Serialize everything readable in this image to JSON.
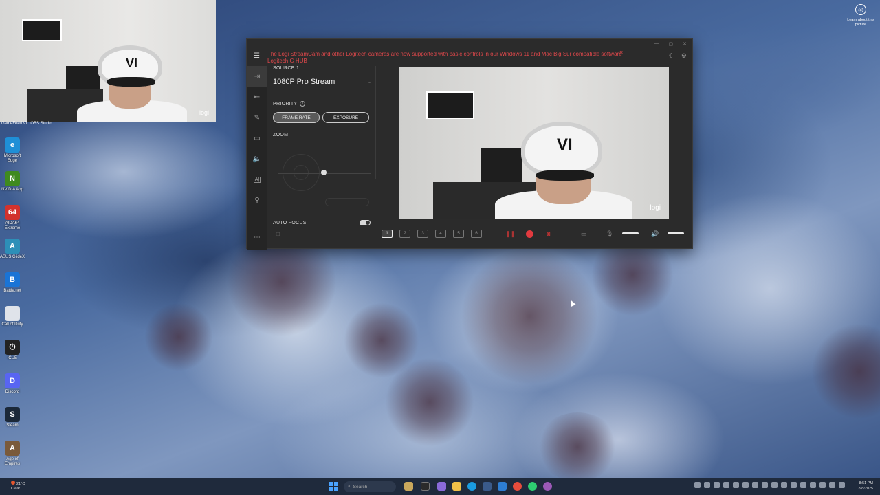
{
  "webcam_overlay": {
    "logo": "logi",
    "cap_text": "VI"
  },
  "desktop": {
    "top_labels": [
      "GameFeed VI",
      "OBS Studio"
    ],
    "icons": [
      {
        "label": "Microsoft Edge",
        "icon": "edge-icon",
        "color": "#1f8fd6",
        "glyph": "e"
      },
      {
        "label": "NVIDIA App",
        "icon": "nvidia-icon",
        "color": "#3f8a1f",
        "glyph": "N"
      },
      {
        "label": "AIDA64 Extreme",
        "icon": "aida64-icon",
        "color": "#d2322d",
        "glyph": "64"
      },
      {
        "label": "ASUS GlideX",
        "icon": "asus-icon",
        "color": "#2d8fb8",
        "glyph": "A"
      },
      {
        "label": "Battle.net",
        "icon": "battlenet-icon",
        "color": "#1a74d6",
        "glyph": "B"
      },
      {
        "label": "Call of Duty",
        "icon": "file-icon",
        "color": "#dfe3ea",
        "glyph": ""
      },
      {
        "label": "iCUE",
        "icon": "icue-icon",
        "color": "#222222",
        "glyph": "⏻"
      },
      {
        "label": "Discord",
        "icon": "discord-icon",
        "color": "#5865f2",
        "glyph": "D"
      },
      {
        "label": "Steam",
        "icon": "steam-icon",
        "color": "#1b2838",
        "glyph": "S"
      },
      {
        "label": "Age of Empires",
        "icon": "aoe-icon",
        "color": "#7a5a3a",
        "glyph": "A"
      }
    ]
  },
  "learn": {
    "label": "Learn about this picture"
  },
  "app": {
    "banner": "The Logi StreamCam and other Logitech cameras are now supported with basic controls in our Windows 11 and Mac Big Sur compatible software Logitech G HUB",
    "banner_close": "×",
    "source_label": "SOURCE 1",
    "source_value": "1080P Pro Stream",
    "priority_label": "PRIORITY",
    "priority_options": [
      "FRAME RATE",
      "EXPOSURE"
    ],
    "zoom_label": "ZOOM",
    "zoom_value": 0.49,
    "autofocus_label": "AUTO FOCUS",
    "autofocus_on": true,
    "preview_logo": "logi",
    "layouts": [
      "1",
      "2",
      "3",
      "4",
      "5",
      "6"
    ],
    "accent": "#e23a3f"
  },
  "taskbar": {
    "weather_temp": "21°C",
    "weather_desc": "Clear",
    "search_placeholder": "Search",
    "time": "8:51 PM",
    "date": "8/8/2025"
  }
}
